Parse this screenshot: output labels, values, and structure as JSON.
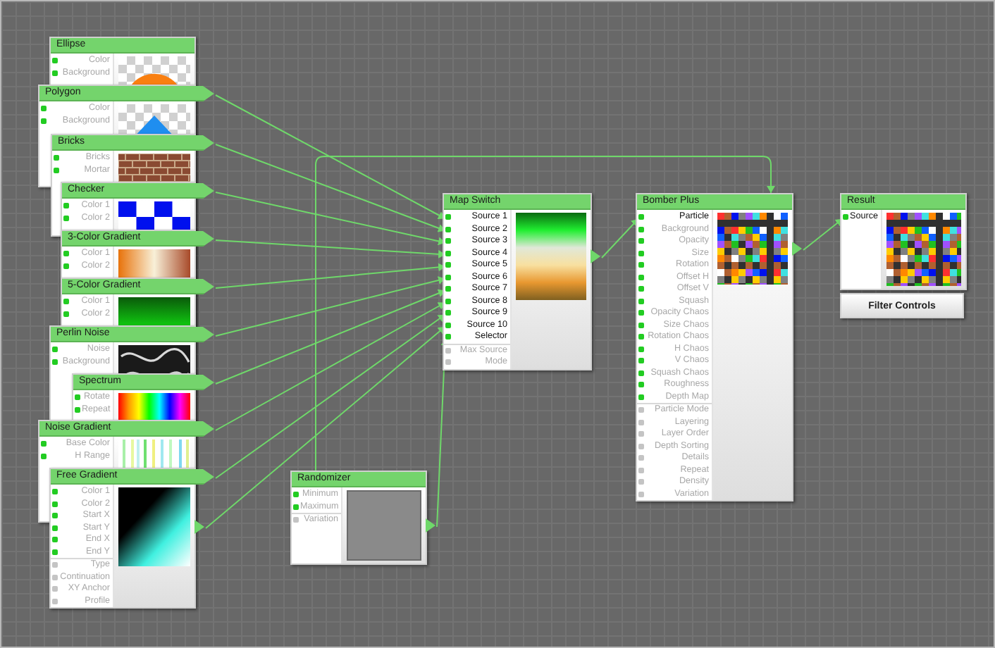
{
  "nodes": [
    {
      "title": "Ellipse",
      "param_groups": [
        [
          {
            "label": "Color",
            "connected": false
          },
          {
            "label": "Background",
            "connected": false
          }
        ]
      ]
    },
    {
      "title": "Polygon",
      "param_groups": [
        [
          {
            "label": "Color",
            "connected": false
          },
          {
            "label": "Background",
            "connected": false
          }
        ]
      ]
    },
    {
      "title": "Bricks",
      "param_groups": [
        [
          {
            "label": "Bricks",
            "connected": false
          },
          {
            "label": "Mortar",
            "connected": false
          }
        ]
      ]
    },
    {
      "title": "Checker",
      "param_groups": [
        [
          {
            "label": "Color 1",
            "connected": false
          },
          {
            "label": "Color 2",
            "connected": false
          }
        ]
      ]
    },
    {
      "title": "3-Color Gradient",
      "param_groups": [
        [
          {
            "label": "Color 1",
            "connected": false
          },
          {
            "label": "Color 2",
            "connected": false
          }
        ]
      ]
    },
    {
      "title": "5-Color Gradient",
      "param_groups": [
        [
          {
            "label": "Color 1",
            "connected": false
          },
          {
            "label": "Color 2",
            "connected": false
          }
        ]
      ]
    },
    {
      "title": "Perlin Noise",
      "param_groups": [
        [
          {
            "label": "Noise",
            "connected": false
          },
          {
            "label": "Background",
            "connected": false
          }
        ]
      ]
    },
    {
      "title": "Spectrum",
      "param_groups": [
        [
          {
            "label": "Rotate",
            "connected": false
          },
          {
            "label": "Repeat",
            "connected": false
          }
        ]
      ]
    },
    {
      "title": "Noise Gradient",
      "param_groups": [
        [
          {
            "label": "Base Color",
            "connected": false
          },
          {
            "label": "H Range",
            "connected": false
          }
        ]
      ]
    },
    {
      "title": "Free Gradient",
      "param_groups": [
        [
          {
            "label": "Color 1",
            "connected": false
          },
          {
            "label": "Color 2",
            "connected": false
          },
          {
            "label": "Start X",
            "connected": false
          },
          {
            "label": "Start Y",
            "connected": false
          },
          {
            "label": "End X",
            "connected": false
          },
          {
            "label": "End Y",
            "connected": false
          }
        ],
        [
          {
            "label": "Type",
            "connected": false
          },
          {
            "label": "Continuation",
            "connected": false
          },
          {
            "label": "XY Anchor",
            "connected": false
          },
          {
            "label": "Profile",
            "connected": false
          }
        ]
      ]
    },
    {
      "title": "Randomizer",
      "param_groups": [
        [
          {
            "label": "Minimum",
            "connected": false
          },
          {
            "label": "Maximum",
            "connected": false
          }
        ],
        [
          {
            "label": "Variation",
            "connected": false
          }
        ]
      ]
    },
    {
      "title": "Map Switch",
      "param_groups": [
        [
          {
            "label": "Source 1",
            "connected": true
          },
          {
            "label": "Source 2",
            "connected": true
          },
          {
            "label": "Source 3",
            "connected": true
          },
          {
            "label": "Source 4",
            "connected": true
          },
          {
            "label": "Source 5",
            "connected": true
          },
          {
            "label": "Source 6",
            "connected": true
          },
          {
            "label": "Source 7",
            "connected": true
          },
          {
            "label": "Source 8",
            "connected": true
          },
          {
            "label": "Source 9",
            "connected": true
          },
          {
            "label": "Source 10",
            "connected": true
          },
          {
            "label": "Selector",
            "connected": true
          }
        ],
        [
          {
            "label": "Max Source",
            "connected": false
          },
          {
            "label": "Mode",
            "connected": false
          }
        ]
      ]
    },
    {
      "title": "Bomber Plus",
      "param_groups": [
        [
          {
            "label": "Particle",
            "connected": true
          },
          {
            "label": "Background",
            "connected": false
          },
          {
            "label": "Opacity",
            "connected": false
          },
          {
            "label": "Size",
            "connected": false
          },
          {
            "label": "Rotation",
            "connected": false
          },
          {
            "label": "Offset H",
            "connected": false
          },
          {
            "label": "Offset V",
            "connected": false
          },
          {
            "label": "Squash",
            "connected": false
          },
          {
            "label": "Opacity Chaos",
            "connected": false
          },
          {
            "label": "Size Chaos",
            "connected": false
          },
          {
            "label": "Rotation Chaos",
            "connected": false
          },
          {
            "label": "H Chaos",
            "connected": false
          },
          {
            "label": "V Chaos",
            "connected": false
          },
          {
            "label": "Squash Chaos",
            "connected": false
          },
          {
            "label": "Roughness",
            "connected": false
          },
          {
            "label": "Depth Map",
            "connected": false
          }
        ],
        [
          {
            "label": "Particle Mode",
            "connected": false
          },
          {
            "label": "Layering",
            "connected": false
          },
          {
            "label": "Layer Order",
            "connected": false
          },
          {
            "label": "Depth Sorting",
            "connected": false
          },
          {
            "label": "Details",
            "connected": false
          },
          {
            "label": "Repeat",
            "connected": false
          },
          {
            "label": "Density",
            "connected": false
          },
          {
            "label": "Variation",
            "connected": false
          }
        ]
      ]
    },
    {
      "title": "Result",
      "param_groups": [
        [
          {
            "label": "Source",
            "connected": true
          }
        ]
      ]
    }
  ],
  "filter_controls_button": "Filter Controls"
}
